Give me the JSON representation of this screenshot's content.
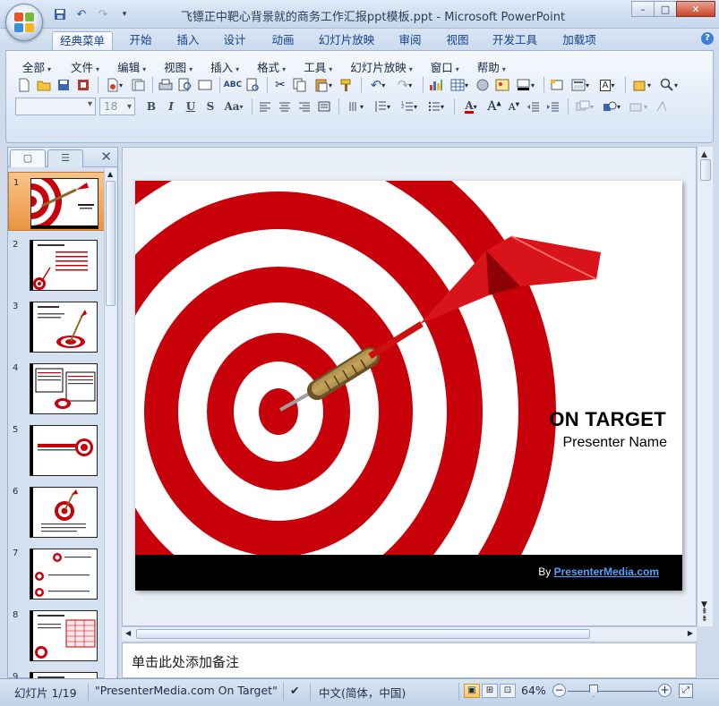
{
  "window": {
    "title": "飞镖正中靶心背景就的商务工作汇报ppt模板.ppt - Microsoft PowerPoint",
    "controls": {
      "minimize": "–",
      "maximize": "□",
      "close": "✕"
    }
  },
  "qat": {
    "save": "💾",
    "undo": "↶",
    "redo": "↷",
    "more": "▾"
  },
  "tabs": [
    {
      "label": "经典菜单",
      "active": true
    },
    {
      "label": "开始"
    },
    {
      "label": "插入"
    },
    {
      "label": "设计"
    },
    {
      "label": "动画"
    },
    {
      "label": "幻灯片放映"
    },
    {
      "label": "审阅"
    },
    {
      "label": "视图"
    },
    {
      "label": "开发工具"
    },
    {
      "label": "加载项"
    }
  ],
  "help": "?",
  "menus": [
    {
      "label": "全部"
    },
    {
      "label": "文件"
    },
    {
      "label": "编辑"
    },
    {
      "label": "视图"
    },
    {
      "label": "插入"
    },
    {
      "label": "格式"
    },
    {
      "label": "工具"
    },
    {
      "label": "幻灯片放映"
    },
    {
      "label": "窗口"
    },
    {
      "label": "帮助"
    }
  ],
  "toolbar": {
    "font_name": "",
    "font_size": "18",
    "bold": "B",
    "italic": "I",
    "underline": "U",
    "shadow": "S",
    "change_case": "Aa",
    "text_style": "A"
  },
  "left_pane": {
    "tab_slides": "▢",
    "tab_outline": "☰",
    "close": "✕",
    "thumbnails": [
      "1",
      "2",
      "3",
      "4",
      "5",
      "6",
      "7",
      "8",
      "9"
    ]
  },
  "slide": {
    "title": "ON TARGET",
    "subtitle": "Presenter Name",
    "by": "By ",
    "link": "PresenterMedia.com"
  },
  "notes_placeholder": "单击此处添加备注",
  "status": {
    "slide_counter": "幻灯片 1/19",
    "theme": "\"PresenterMedia.com On Target\"",
    "language": "中文(简体，中国)",
    "zoom": "64%",
    "zoom_minus": "−",
    "zoom_plus": "+"
  },
  "colors": {
    "target_red": "#c8000a",
    "footer_black": "#000000",
    "link_blue": "#4da3ff",
    "active_thumb": "#f3a95a"
  }
}
